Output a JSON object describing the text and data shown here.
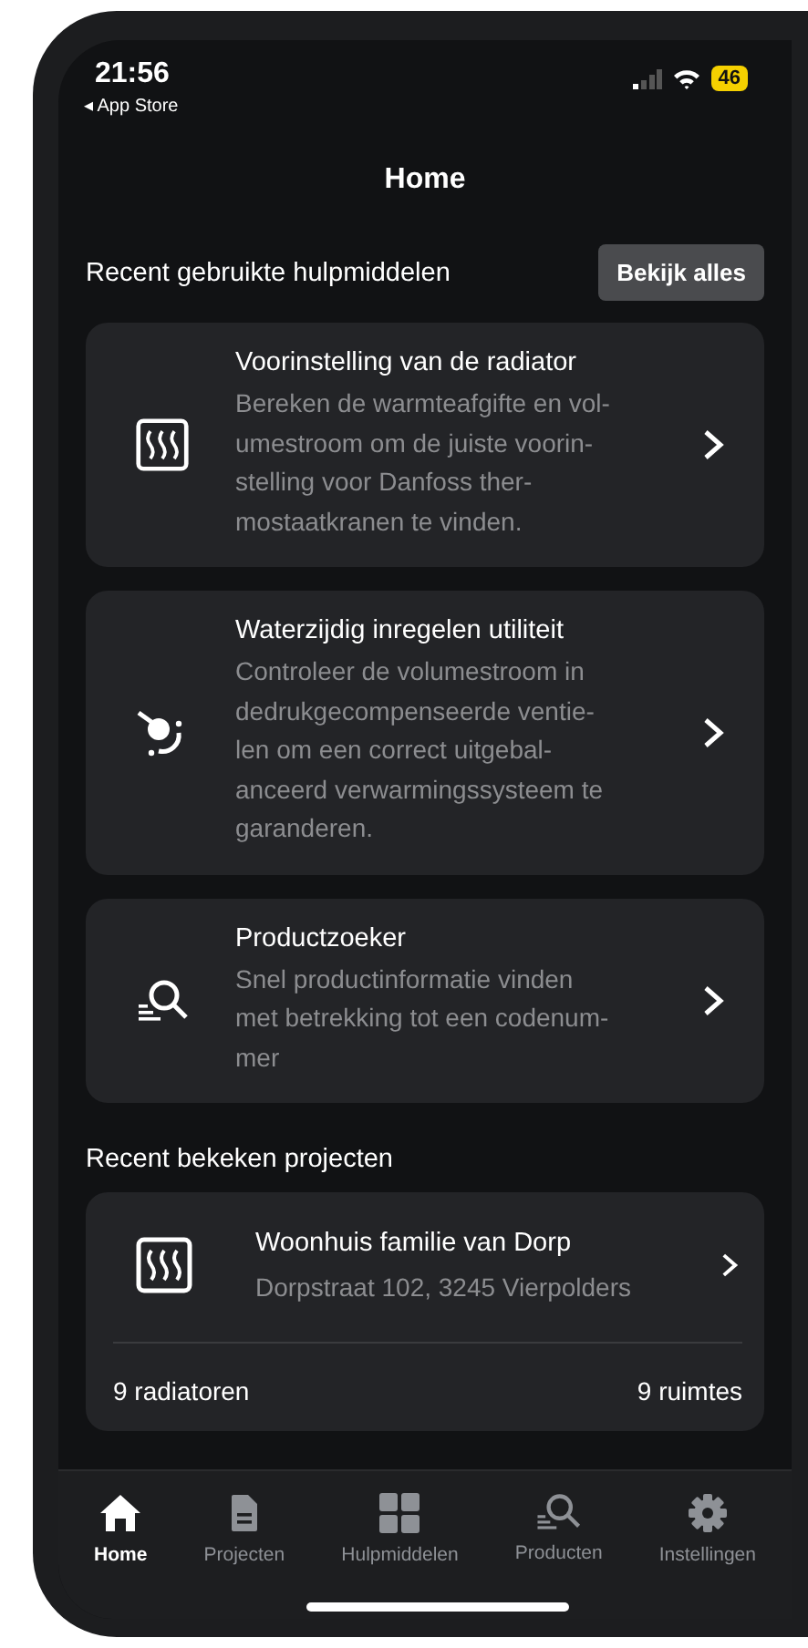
{
  "status_bar": {
    "time": "21:56",
    "back_link": "◂ App Store",
    "battery": "46"
  },
  "header": {
    "title": "Home"
  },
  "tools_section": {
    "title": "Recent gebruikte hulpmiddelen",
    "button": "Bekijk alles",
    "items": [
      {
        "kind": "radiator",
        "title": "Voorinstelling van de radiator",
        "lines": [
          "Bereken de warmteafgifte en vol-",
          "umestroom om de juiste voorin-",
          "stelling voor Danfoss ther-",
          "mostaatkranen te vinden."
        ]
      },
      {
        "kind": "valve",
        "title": "Waterzijdig inregelen utiliteit",
        "lines": [
          "Controleer de volumestroom in",
          "dedrukgecompenseerde ventie-",
          "len om een correct uitgebal-",
          "anceerd verwarmingssysteem te",
          "garanderen."
        ]
      },
      {
        "kind": "search",
        "title": "Productzoeker",
        "lines": [
          "Snel productinformatie vinden",
          "met betrekking tot een codenum-",
          "mer"
        ]
      }
    ]
  },
  "projects_section": {
    "title": "Recent bekeken projecten",
    "items": [
      {
        "kind": "radiator",
        "title": "Woonhuis familie van Dorp",
        "address": "Dorpstraat 102, 3245 Vierpolders",
        "radiators": "9 radiatoren",
        "rooms": "9 ruimtes"
      }
    ]
  },
  "tab_bar": [
    {
      "kind": "home",
      "label": "Home",
      "selected": true
    },
    {
      "kind": "document",
      "label": "Projecten",
      "selected": false
    },
    {
      "kind": "grid",
      "label": "Hulpmiddelen",
      "selected": false
    },
    {
      "kind": "search",
      "label": "Producten",
      "selected": false
    },
    {
      "kind": "gear",
      "label": "Instellingen",
      "selected": false
    }
  ]
}
